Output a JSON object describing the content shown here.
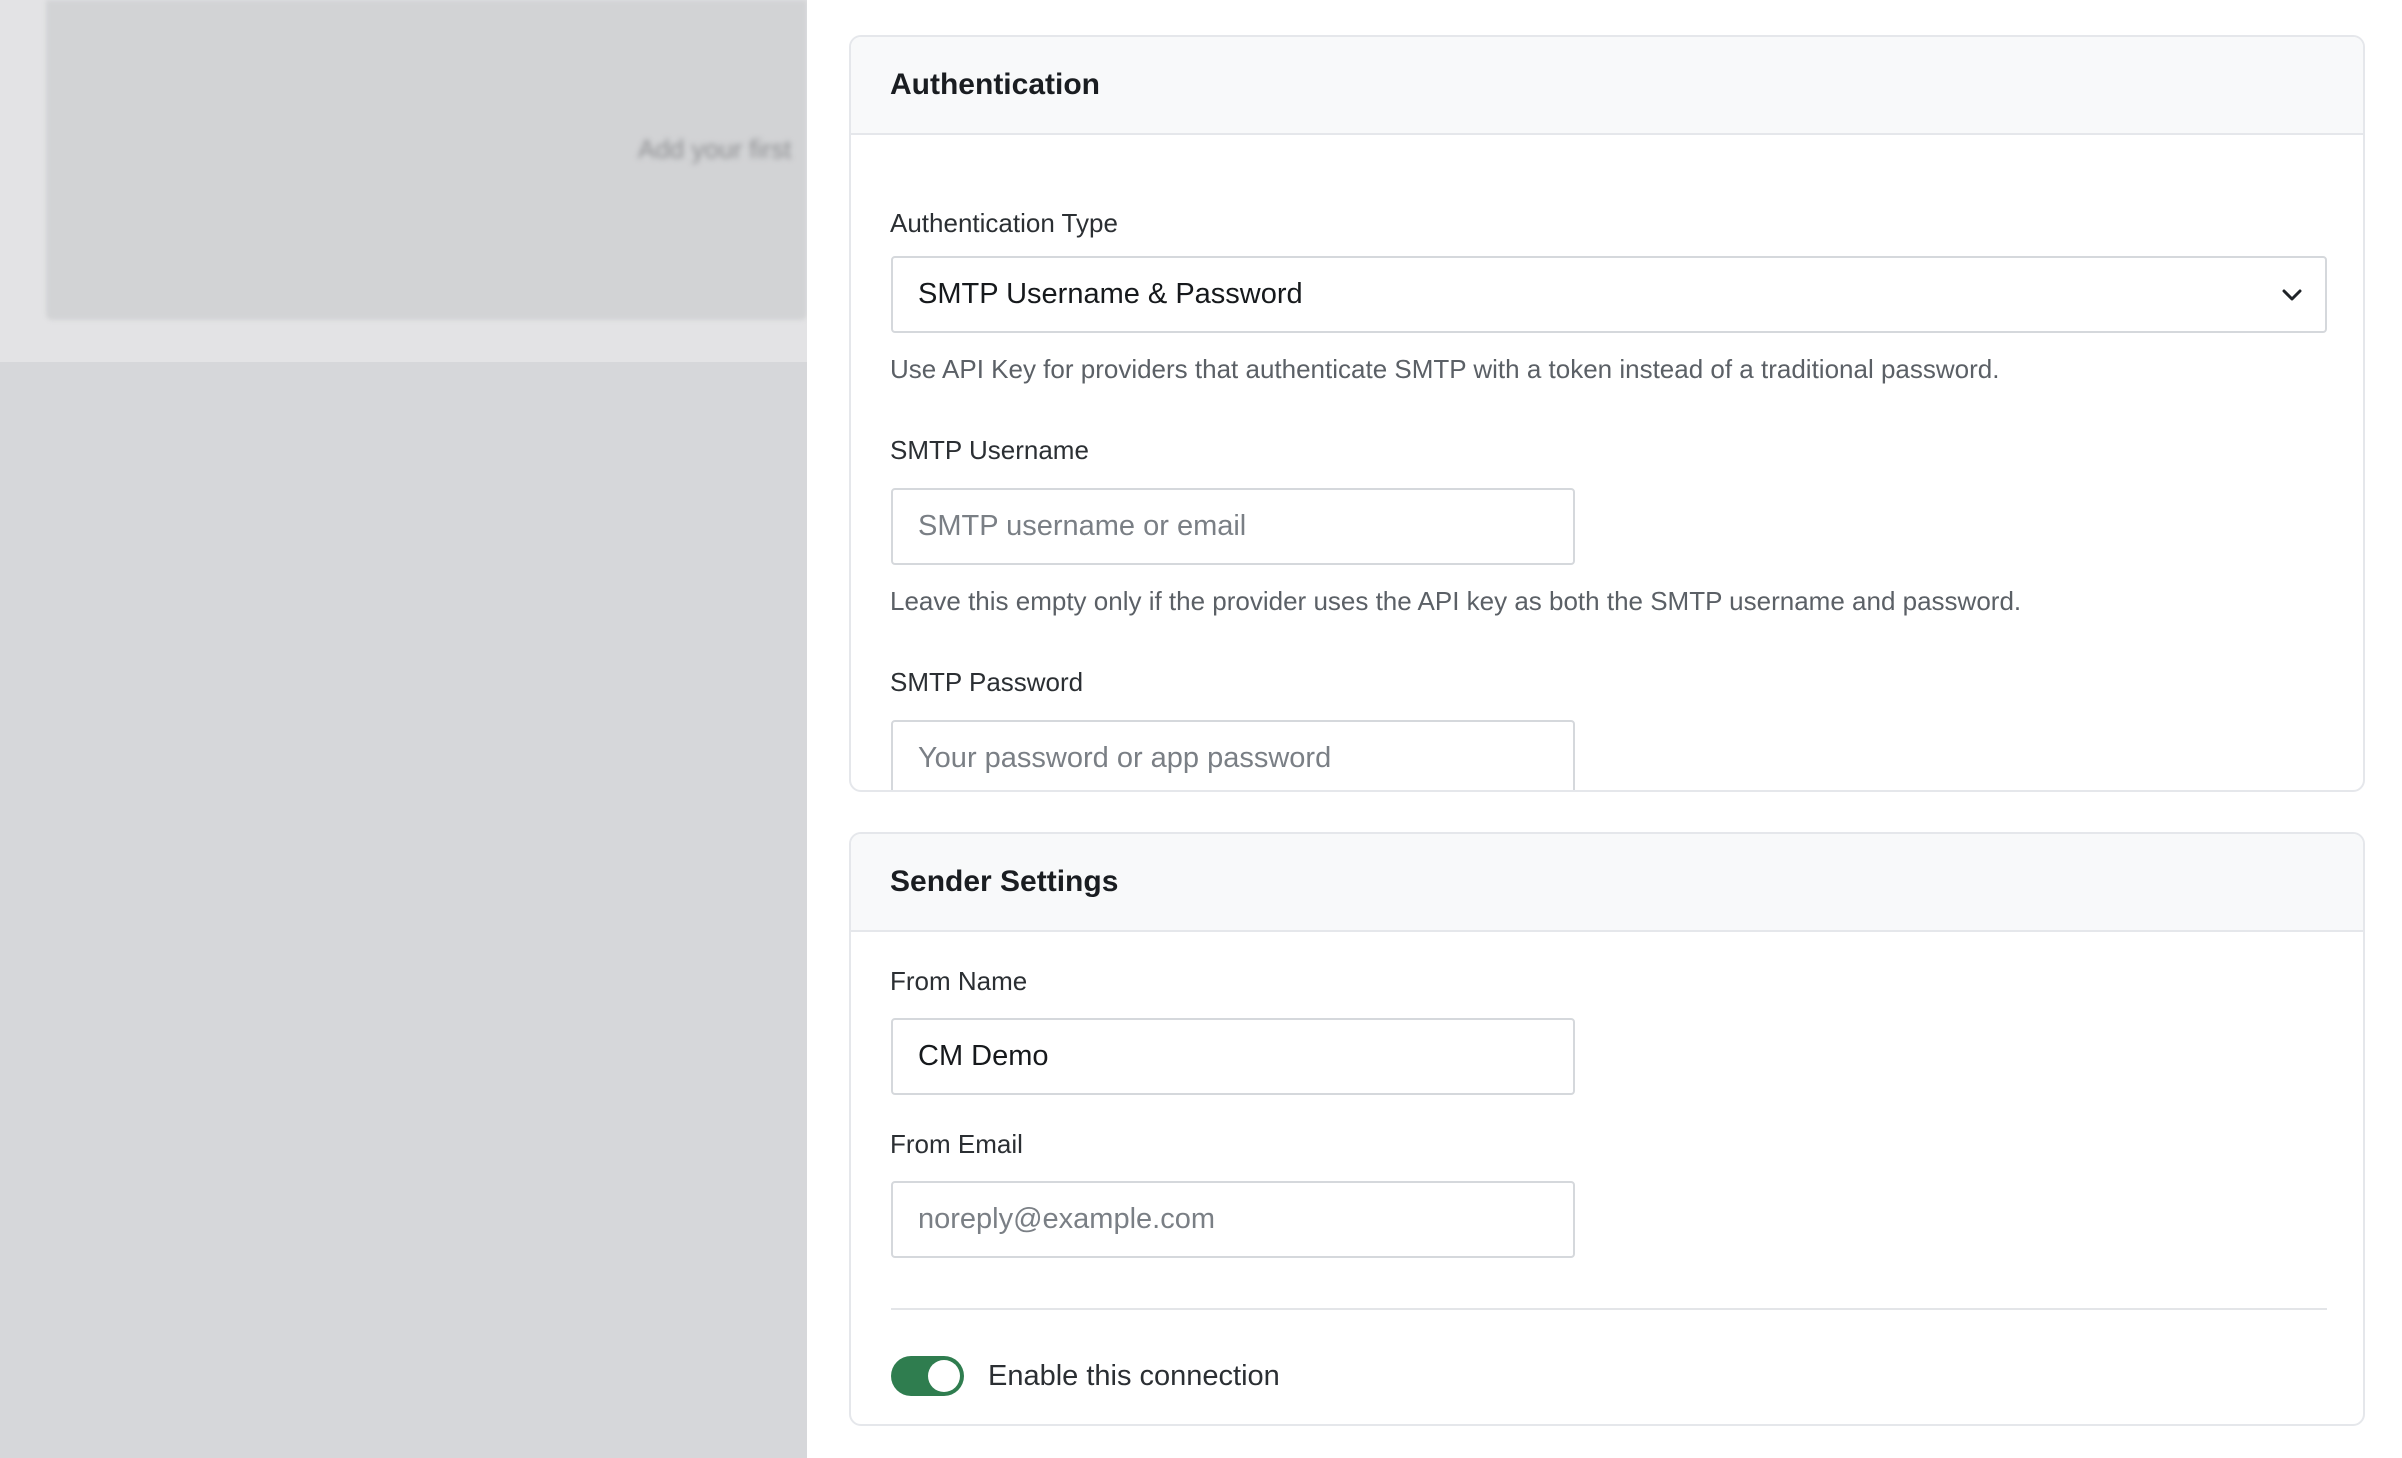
{
  "background": {
    "blurred_text": "Add your first"
  },
  "authentication": {
    "title": "Authentication",
    "auth_type": {
      "label": "Authentication Type",
      "selected": "SMTP Username & Password",
      "help": "Use API Key for providers that authenticate SMTP with a token instead of a traditional password."
    },
    "username": {
      "label": "SMTP Username",
      "value": "",
      "placeholder": "SMTP username or email",
      "help": "Leave this empty only if the provider uses the API key as both the SMTP username and password."
    },
    "password": {
      "label": "SMTP Password",
      "value": "",
      "placeholder": "Your password or app password"
    }
  },
  "sender": {
    "title": "Sender Settings",
    "from_name": {
      "label": "From Name",
      "value": "CM Demo"
    },
    "from_email": {
      "label": "From Email",
      "value": "",
      "placeholder": "noreply@example.com"
    },
    "enable": {
      "label": "Enable this connection",
      "checked": true
    }
  },
  "colors": {
    "toggle_on": "#2f7d4f",
    "card_header_bg": "#f8f9fa",
    "backdrop": "#d7d8db"
  }
}
